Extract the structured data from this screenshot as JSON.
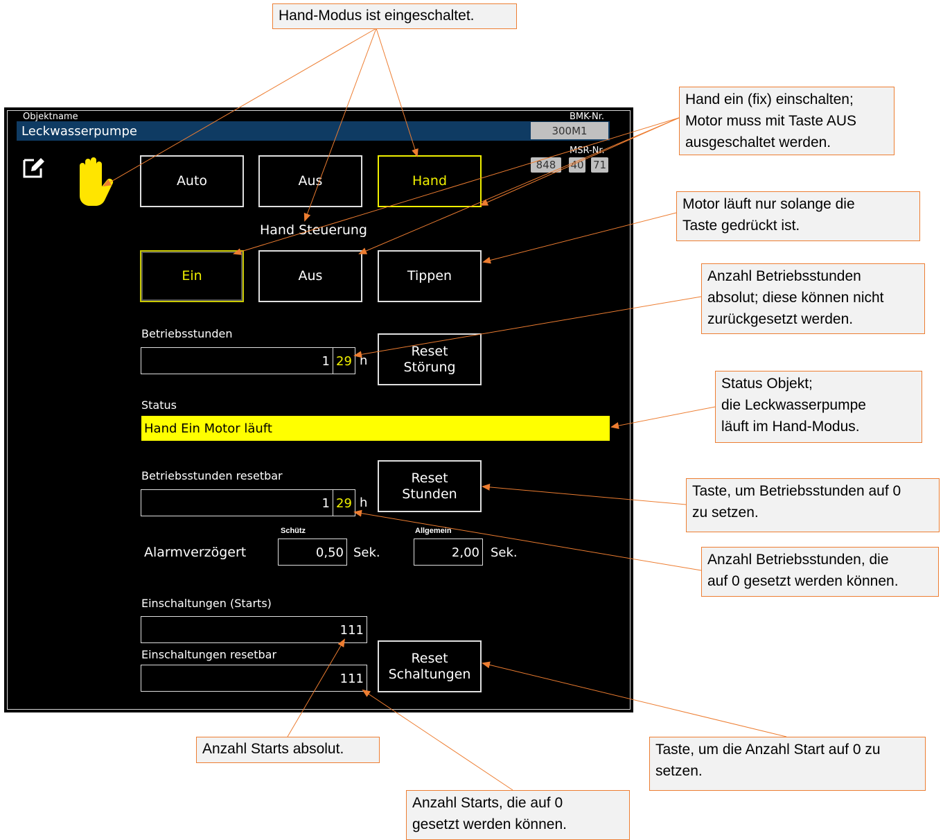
{
  "header": {
    "objektname_label": "Objektname",
    "objektname_value": "Leckwasserpumpe",
    "bmk_label": "BMK-Nr.",
    "bmk_value": "300M1",
    "msr_label": "MSR-Nr.",
    "msr_values": [
      "848",
      "40",
      "71"
    ]
  },
  "mode_buttons": {
    "auto": "Auto",
    "aus": "Aus",
    "hand": "Hand",
    "active": "Hand"
  },
  "hand_control": {
    "title": "Hand Steuerung",
    "ein": "Ein",
    "aus": "Aus",
    "tippen": "Tippen",
    "active": "Ein"
  },
  "betriebsstunden": {
    "label": "Betriebsstunden",
    "value_main": "1",
    "value_minutes": "29",
    "unit": "h",
    "reset_line1": "Reset",
    "reset_line2": "Störung"
  },
  "status": {
    "label": "Status",
    "text": "Hand Ein Motor läuft"
  },
  "betriebsstunden_resetbar": {
    "label": "Betriebsstunden resetbar",
    "value_main": "1",
    "value_minutes": "29",
    "unit": "h",
    "reset_line1": "Reset",
    "reset_line2": "Stunden"
  },
  "alarm": {
    "label": "Alarmverzögert",
    "schuetz_label": "Schütz",
    "schuetz_value": "0,50",
    "schuetz_unit": "Sek.",
    "allgemein_label": "Allgemein",
    "allgemein_value": "2,00",
    "allgemein_unit": "Sek."
  },
  "einschaltungen": {
    "label": "Einschaltungen (Starts)",
    "value": "111",
    "resetbar_label": "Einschaltungen resetbar",
    "resetbar_value": "111",
    "reset_line1": "Reset",
    "reset_line2": "Schaltungen"
  },
  "callouts": {
    "hand_modus": "Hand-Modus ist eingeschaltet.",
    "hand_ein_line1": "Hand ein (fix) einschalten;",
    "hand_ein_line2": "Motor muss mit Taste AUS",
    "hand_ein_line3": "ausgeschaltet werden.",
    "tippen_line1": "Motor läuft nur solange die",
    "tippen_line2": "Taste gedrückt ist.",
    "bst_abs_line1": "Anzahl Betriebsstunden",
    "bst_abs_line2": "absolut; diese können nicht",
    "bst_abs_line3": "zurückgesetzt werden.",
    "status_line1": "Status Objekt;",
    "status_line2": "die Leckwasserpumpe",
    "status_line3": "läuft im Hand-Modus.",
    "reset_stunden_line1": "Taste, um Betriebsstunden auf 0",
    "reset_stunden_line2": "zu setzen.",
    "bst_res_line1": "Anzahl Betriebsstunden, die",
    "bst_res_line2": "auf 0 gesetzt werden können.",
    "starts_abs": "Anzahl Starts absolut.",
    "reset_starts_line1": "Taste, um die Anzahl Start auf 0 zu",
    "reset_starts_line2": "setzen.",
    "starts_res_line1": "Anzahl Starts, die auf 0",
    "starts_res_line2": "gesetzt werden können."
  },
  "colors": {
    "accent": "#f0f000",
    "callout_border": "#ed7d31",
    "title_bar": "#0f3b63"
  },
  "icons": {
    "edit": "edit-icon",
    "hand": "hand-icon"
  }
}
